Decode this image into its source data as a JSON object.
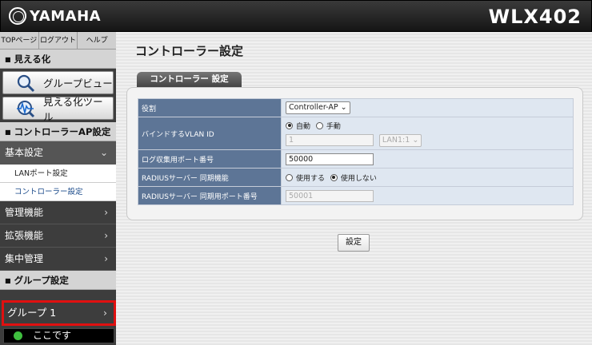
{
  "header": {
    "brand": "YAMAHA",
    "model": "WLX402"
  },
  "sidebar": {
    "top_links": [
      "TOPページ",
      "ログアウト",
      "ヘルプ"
    ],
    "visualize_heading": "見える化",
    "group_view_label": "グループビュー",
    "visualize_tool_label": "見える化ツール",
    "controller_heading": "コントローラーAP設定",
    "basic_settings_label": "基本設定",
    "sub_lan_port": "LANポート設定",
    "sub_controller": "コントローラー設定",
    "management_label": "管理機能",
    "extension_label": "拡張機能",
    "central_label": "集中管理",
    "group_heading": "グループ設定",
    "group1_label": "グループ 1",
    "here_label": "ここです",
    "chevron": "›",
    "chevron_down": "⌄"
  },
  "main": {
    "page_title": "コントローラー設定",
    "tab_label": "コントローラー 設定",
    "rows": {
      "role": {
        "label": "役割",
        "value": "Controller-AP"
      },
      "vlan": {
        "label": "バインドするVLAN ID",
        "auto": "自動",
        "manual": "手動",
        "vlan_value": "1",
        "port_value": "LAN1:1"
      },
      "log_port": {
        "label": "ログ収集用ポート番号",
        "value": "50000"
      },
      "radius_sync": {
        "label": "RADIUSサーバー 同期機能",
        "use": "使用する",
        "nouse": "使用しない"
      },
      "radius_port": {
        "label": "RADIUSサーバー 同期用ポート番号",
        "value": "50001"
      }
    },
    "submit_label": "設定"
  },
  "colors": {
    "label_bg": "#5d7596",
    "value_bg": "#dfe7f1",
    "highlight": "#e01010"
  }
}
